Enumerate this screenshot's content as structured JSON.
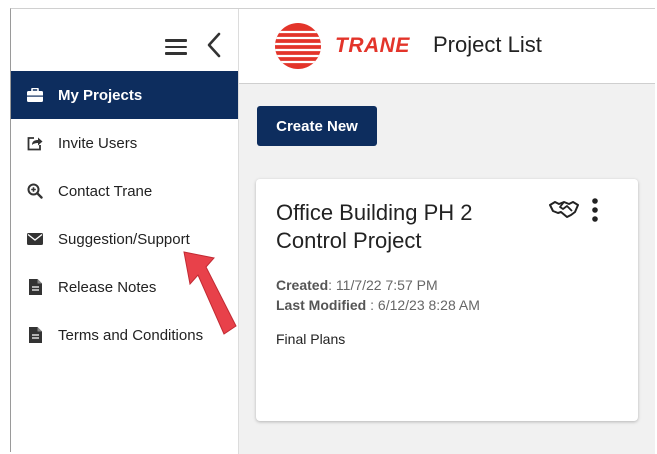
{
  "sidebar": {
    "items": [
      {
        "label": "My Projects",
        "icon": "briefcase-icon",
        "active": true
      },
      {
        "label": "Invite Users",
        "icon": "share-icon"
      },
      {
        "label": "Contact Trane",
        "icon": "zoom-icon"
      },
      {
        "label": "Suggestion/Support",
        "icon": "envelope-icon"
      },
      {
        "label": "Release Notes",
        "icon": "document-icon"
      },
      {
        "label": "Terms and Conditions",
        "icon": "document-icon"
      }
    ]
  },
  "header": {
    "brand": "TRANE",
    "title": "Project List"
  },
  "main": {
    "create_label": "Create New",
    "project": {
      "title": "Office Building PH 2 Control Project",
      "created_label": "Created",
      "created_value": ": 11/7/22 7:57 PM",
      "modified_label": "Last Modified",
      "modified_value": " : 6/12/23 8:28 AM",
      "note": "Final Plans"
    }
  },
  "colors": {
    "navy": "#0d2d5e",
    "brand_red": "#e3342a",
    "arrow_red": "#e8414a"
  }
}
